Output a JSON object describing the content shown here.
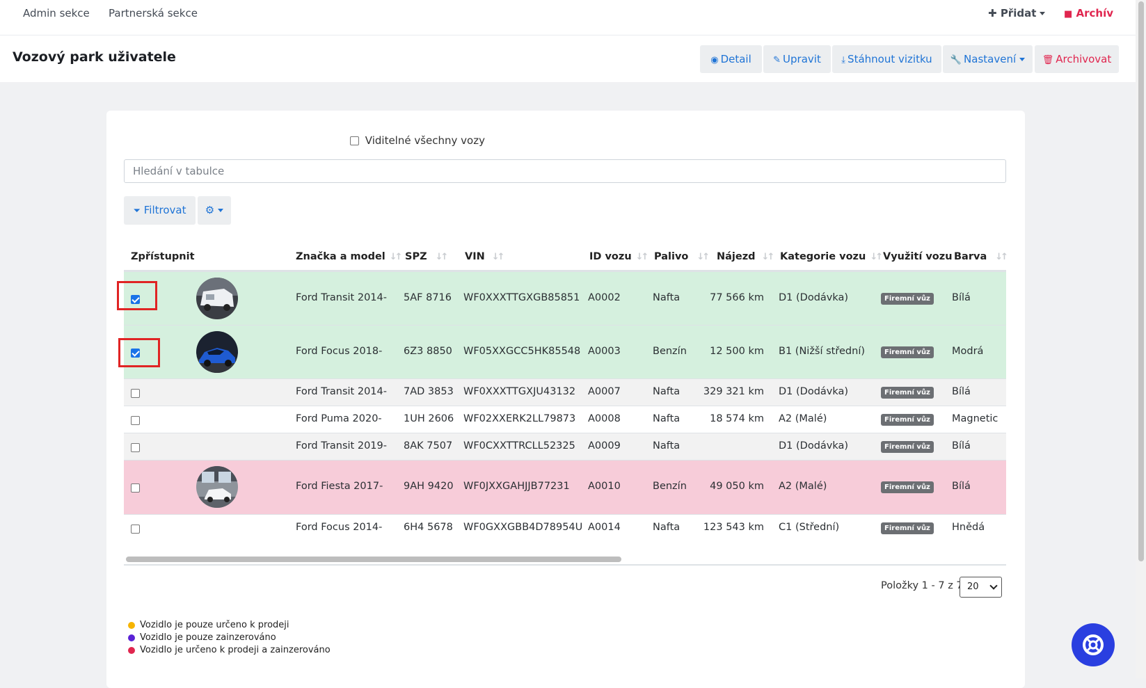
{
  "nav": {
    "admin": "Admin sekce",
    "partner": "Partnerská sekce",
    "pridat": "Přidat",
    "archiv": "Archív"
  },
  "header": {
    "title": "Vozový park uživatele",
    "buttons": {
      "detail": "Detail",
      "upravit": "Upravit",
      "stahnout": "Stáhnout vizitku",
      "nastaveni": "Nastavení",
      "archivovat": "Archivovat"
    }
  },
  "filters": {
    "all_visible": "Viditelné všechny vozy",
    "search_placeholder": "Hledání v tabulce",
    "filter_btn": "Filtrovat"
  },
  "table": {
    "columns": {
      "access": "Zpřístupnit",
      "model": "Značka a model",
      "spz": "SPZ",
      "vin": "VIN",
      "id": "ID vozu",
      "fuel": "Palivo",
      "mileage": "Nájezd",
      "category": "Kategorie vozu",
      "usage": "Využití vozu",
      "color": "Barva"
    },
    "rows": [
      {
        "checked": true,
        "photo": "van",
        "model": "Ford Transit 2014-",
        "spz": "5AF 8716",
        "vin": "WF0XXXTTGXGB85851",
        "id": "A0002",
        "fuel": "Nafta",
        "mileage": "77 566 km",
        "category": "D1 (Dodávka)",
        "usage": "Firemní vůz",
        "color": "Bílá"
      },
      {
        "checked": true,
        "photo": "focus",
        "model": "Ford Focus 2018-",
        "spz": "6Z3 8850",
        "vin": "WF05XXGCC5HK85548",
        "id": "A0003",
        "fuel": "Benzín",
        "mileage": "12 500 km",
        "category": "B1 (Nižší střední)",
        "usage": "Firemní vůz",
        "color": "Modrá"
      },
      {
        "checked": false,
        "photo": "",
        "model": "Ford Transit 2014-",
        "spz": "7AD 3853",
        "vin": "WF0XXXTTGXJU43132",
        "id": "A0007",
        "fuel": "Nafta",
        "mileage": "329 321 km",
        "category": "D1 (Dodávka)",
        "usage": "Firemní vůz",
        "color": "Bílá"
      },
      {
        "checked": false,
        "photo": "",
        "model": "Ford Puma 2020-",
        "spz": "1UH 2606",
        "vin": "WF02XXERK2LL79873",
        "id": "A0008",
        "fuel": "Nafta",
        "mileage": "18 574 km",
        "category": "A2 (Malé)",
        "usage": "Firemní vůz",
        "color": "Magnetic"
      },
      {
        "checked": false,
        "photo": "",
        "model": "Ford Transit 2019-",
        "spz": "8AK 7507",
        "vin": "WF0CXXTTRCLL52325",
        "id": "A0009",
        "fuel": "Nafta",
        "mileage": "",
        "category": "D1 (Dodávka)",
        "usage": "Firemní vůz",
        "color": "Bílá"
      },
      {
        "checked": false,
        "photo": "fiesta",
        "model": "Ford Fiesta 2017-",
        "spz": "9AH 9420",
        "vin": "WF0JXXGAHJJB77231",
        "id": "A0010",
        "fuel": "Benzín",
        "mileage": "49 050 km",
        "category": "A2 (Malé)",
        "usage": "Firemní vůz",
        "color": "Bílá"
      },
      {
        "checked": false,
        "photo": "",
        "model": "Ford Focus 2014-",
        "spz": "6H4 5678",
        "vin": "WF0GXXGBB4D78954U",
        "id": "A0014",
        "fuel": "Nafta",
        "mileage": "123 543 km",
        "category": "C1 (Střední)",
        "usage": "Firemní vůz",
        "color": "Hnědá"
      }
    ],
    "row_colors": [
      "#d5f0de",
      "#d5f0de",
      "#f2f2f2",
      "#ffffff",
      "#f2f2f2",
      "#f7ccd9",
      "#ffffff"
    ]
  },
  "pagination": {
    "info": "Položky 1 - 7 z 7",
    "page_size": "20"
  },
  "legend": [
    {
      "text": "Vozidlo je pouze určeno k prodeji",
      "color": "#f6b400"
    },
    {
      "text": "Vozidlo je pouze zainzerováno",
      "color": "#5a22d6"
    },
    {
      "text": "Vozidlo je určeno k prodeji a zainzerováno",
      "color": "#e0264f"
    }
  ]
}
